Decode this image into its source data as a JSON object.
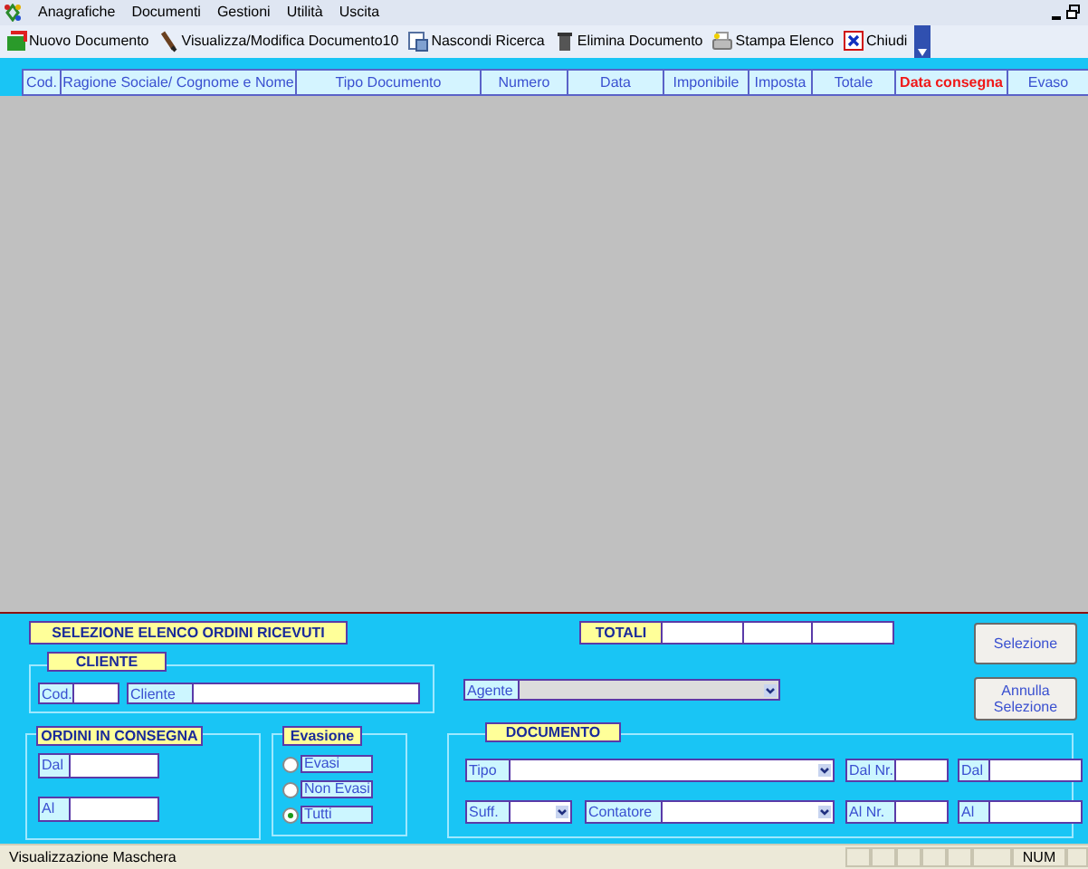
{
  "menu": [
    "Anagrafiche",
    "Documenti",
    "Gestioni",
    "Utilità",
    "Uscita"
  ],
  "toolbar": [
    {
      "label": "Nuovo Documento"
    },
    {
      "label": "Visualizza/Modifica Documento10"
    },
    {
      "label": "Nascondi Ricerca"
    },
    {
      "label": "Elimina Documento"
    },
    {
      "label": "Stampa Elenco"
    },
    {
      "label": "Chiudi"
    }
  ],
  "table": {
    "columns": [
      {
        "label": "Cod.",
        "highlighted": false
      },
      {
        "label": "Ragione Sociale/ Cognome e Nome",
        "highlighted": false
      },
      {
        "label": "Tipo Documento",
        "highlighted": false
      },
      {
        "label": "Numero",
        "highlighted": false
      },
      {
        "label": "Data",
        "highlighted": false
      },
      {
        "label": "Imponibile",
        "highlighted": false
      },
      {
        "label": "Imposta",
        "highlighted": false
      },
      {
        "label": "Totale",
        "highlighted": false
      },
      {
        "label": "Data consegna",
        "highlighted": true
      },
      {
        "label": "Evaso",
        "highlighted": false
      }
    ]
  },
  "selection_title": "SELEZIONE ELENCO ORDINI RICEVUTI",
  "cliente": {
    "title": "CLIENTE",
    "fields": [
      {
        "label": "Cod."
      },
      {
        "label": "Cliente"
      }
    ]
  },
  "ordini_in_consegna": {
    "title": "ORDINI IN CONSEGNA",
    "fields": [
      {
        "label": "Dal"
      },
      {
        "label": "Al"
      }
    ]
  },
  "evasione": {
    "title": "Evasione",
    "options": [
      {
        "label": "Evasi",
        "selected": false
      },
      {
        "label": "Non Evasi",
        "selected": false
      },
      {
        "label": "Tutti",
        "selected": true
      }
    ]
  },
  "totali": {
    "title": "TOTALI"
  },
  "agente": {
    "label": "Agente",
    "disabled": true
  },
  "buttons": [
    "Selezione",
    "Annulla Selezione"
  ],
  "documento": {
    "title": "DOCUMENTO",
    "fields": [
      {
        "label": "Tipo",
        "kind": "combo"
      },
      {
        "label": "Dal Nr.",
        "kind": "text"
      },
      {
        "label": "Dal",
        "kind": "text"
      },
      {
        "label": "Suff.",
        "kind": "combo"
      },
      {
        "label": "Contatore",
        "kind": "combo"
      },
      {
        "label": "Al Nr.",
        "kind": "text"
      },
      {
        "label": "Al",
        "kind": "text"
      }
    ]
  },
  "status_bar": {
    "message": "Visualizzazione Maschera",
    "indicator": "NUM"
  }
}
